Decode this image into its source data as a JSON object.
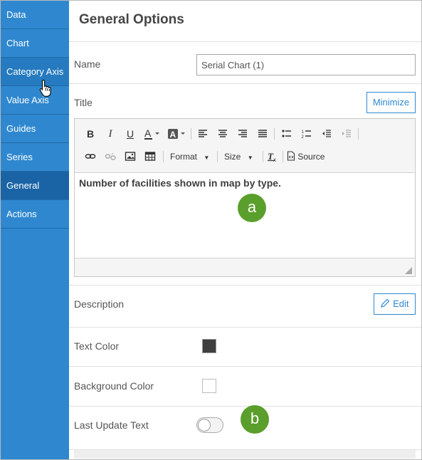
{
  "sidebar": {
    "items": [
      {
        "label": "Data"
      },
      {
        "label": "Chart"
      },
      {
        "label": "Category Axis"
      },
      {
        "label": "Value Axis"
      },
      {
        "label": "Guides"
      },
      {
        "label": "Series"
      },
      {
        "label": "General"
      },
      {
        "label": "Actions"
      }
    ],
    "active": "General",
    "hovered": "Category Axis"
  },
  "main": {
    "title": "General Options",
    "name": {
      "label": "Name",
      "value": "Serial Chart (1)"
    },
    "title_field": {
      "label": "Title",
      "minimize_label": "Minimize"
    },
    "editor": {
      "toolbar": {
        "format_label": "Format",
        "size_label": "Size",
        "source_label": "Source"
      },
      "content": "Number of facilities shown in map by type."
    },
    "description": {
      "label": "Description",
      "edit_label": "Edit"
    },
    "text_color": {
      "label": "Text Color",
      "value": "#3f3f3f"
    },
    "background_color": {
      "label": "Background Color",
      "value": "#ffffff"
    },
    "last_update_text": {
      "label": "Last Update Text",
      "enabled": false
    }
  },
  "callouts": {
    "a": "a",
    "b": "b"
  },
  "colors": {
    "accent": "#2f88cf",
    "sidebar": "#2f88cf",
    "sidebar_active": "#1a64a5",
    "callout": "#5a9e2c"
  }
}
